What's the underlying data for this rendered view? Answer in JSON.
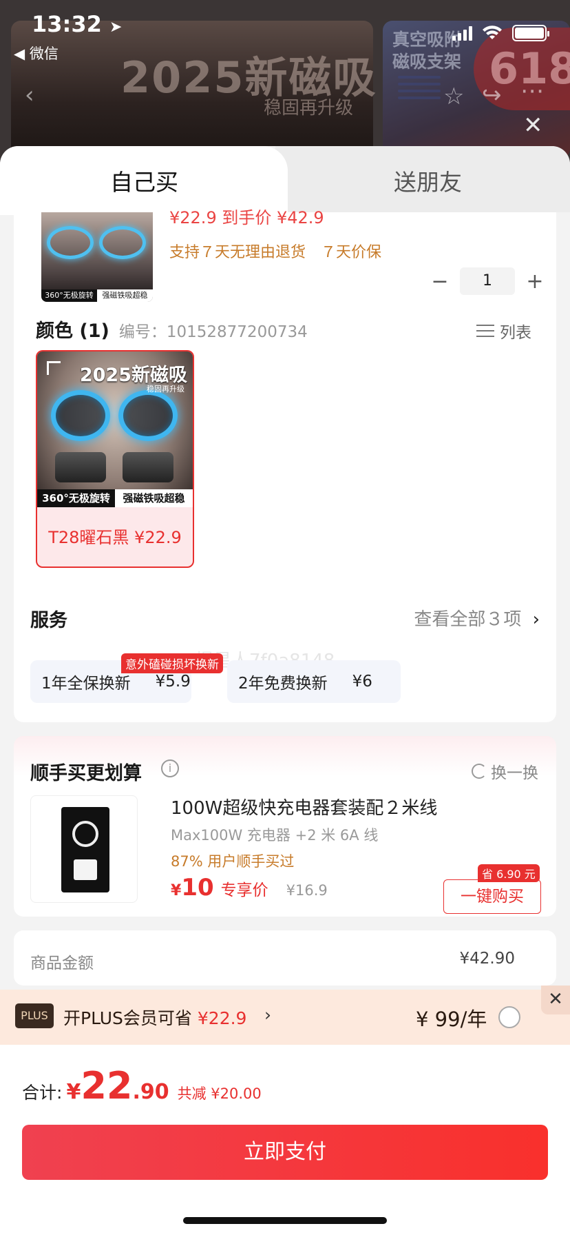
{
  "status_bar": {
    "time": "13:32",
    "back_app": "◀ 微信"
  },
  "background": {
    "banner_title": "2025新磁吸",
    "banner_sub": "稳固再升级",
    "thumb_title_1": "真空吸附",
    "thumb_title_2": "磁吸支架",
    "promo": "618"
  },
  "tabs": {
    "self_buy": "自己买",
    "gift": "送朋友"
  },
  "product": {
    "cut_price_text": "¥22.9 到手价 ¥42.9",
    "service_guarantee": "支持７天无理由退货　７天价保",
    "quantity": "1",
    "img_cap_left": "360°无极旋转",
    "img_cap_right": "强磁铁吸超稳"
  },
  "color_section": {
    "title": "颜色 (1)",
    "code": "编号：10152877200734",
    "list_label": "列表"
  },
  "variant": {
    "title": "2025新磁吸",
    "sub": "稳固再升级",
    "cap_left": "360°无极旋转",
    "cap_right": "强磁铁吸超稳",
    "label": "T28曜石黑  ¥22.9"
  },
  "watermark": "慢星人7f0a8148-",
  "services": {
    "title": "服务",
    "view_all": "查看全部３项",
    "options": [
      {
        "name": "1年全保换新",
        "price": "¥5.9",
        "tag": "意外磕碰损坏换新"
      },
      {
        "name": "2年免费换新",
        "price": "¥6"
      }
    ]
  },
  "addon": {
    "title": "顺手买更划算",
    "refresh": "换一换",
    "name": "100W超级快充电器套装配２米线",
    "sub": "Max100W 充电器 +2 米 6A 线",
    "bought": "87% 用户顺手买过",
    "price_cur": "¥",
    "price": "10",
    "exclusive": "专享价",
    "orig_price": "¥16.9",
    "save_tag": "省 6.90 元",
    "buy_button": "一键购买"
  },
  "totals": {
    "label": "商品金额",
    "value": "¥42.90"
  },
  "plus": {
    "badge": "PLUS",
    "text_prefix": "开PLUS会员可省",
    "text_amount": "¥22.9",
    "price": "¥ 99/年"
  },
  "footer": {
    "sum_label": "合计:",
    "sum_cur": "¥",
    "sum_int": "22",
    "sum_dec": ".90",
    "sum_save": "共减 ¥20.00",
    "pay_button": "立即支付"
  },
  "colors": {
    "accent": "#e8302f",
    "gold": "#c77b2a"
  }
}
